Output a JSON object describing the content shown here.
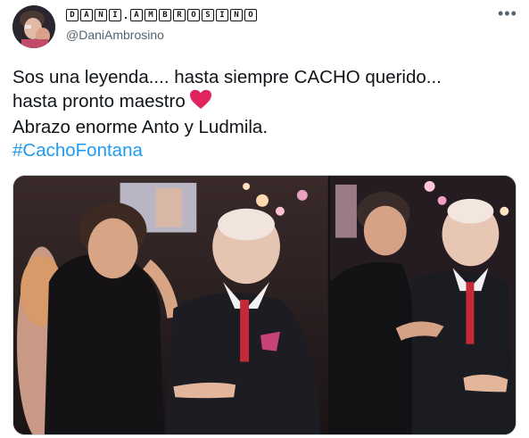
{
  "author": {
    "display_name_letters": [
      "D",
      "A",
      "N",
      "I",
      ".",
      "A",
      "M",
      "B",
      "R",
      "O",
      "S",
      "I",
      "N",
      "O"
    ],
    "handle": "@DaniAmbrosino"
  },
  "more_options_icon": "more-horizontal-icon",
  "tweet": {
    "line1": "Sos una leyenda.... hasta siempre CACHO querido...",
    "line2": "hasta pronto maestro",
    "line2_emoji": "heart-icon",
    "line3": "Abrazo enorme Anto y Ludmila.",
    "hashtag": "#CachoFontana"
  },
  "colors": {
    "text": "#0f1419",
    "secondary": "#536471",
    "hashtag": "#1d9bf0",
    "heart": "#e0245e"
  }
}
